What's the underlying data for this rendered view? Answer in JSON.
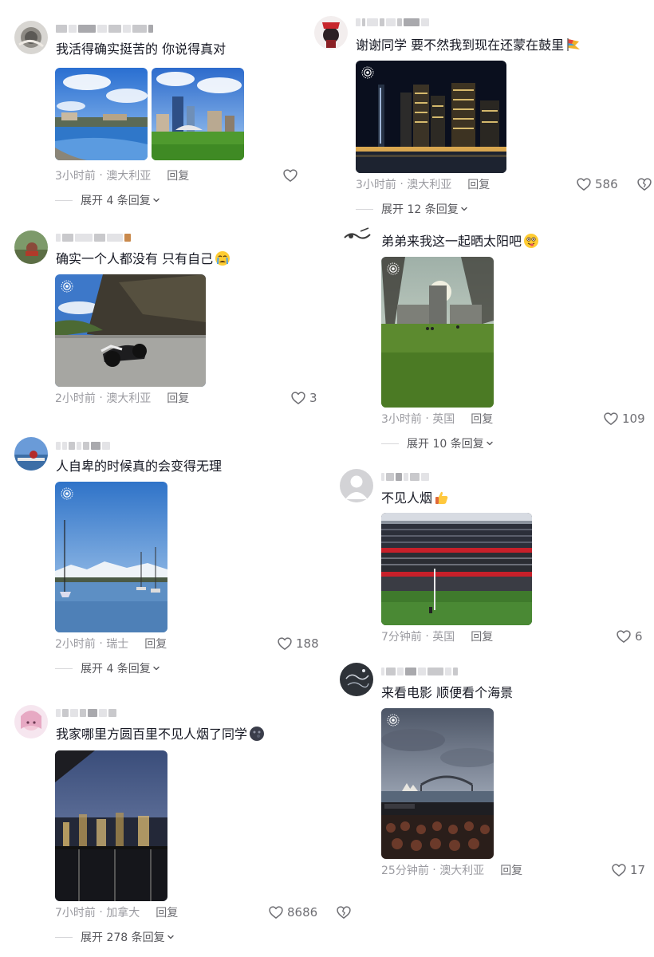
{
  "comments": [
    {
      "text": "我活得确实挺苦的 你说得真对",
      "time": "3小时前",
      "location": "澳大利亚",
      "reply": "回复",
      "likes": "",
      "expand": "展开 4 条回复"
    },
    {
      "text": "确实一个人都没有 只有自己",
      "time": "2小时前",
      "location": "澳大利亚",
      "reply": "回复",
      "likes": "3",
      "expand": ""
    },
    {
      "text": "人自卑的时候真的会变得无理",
      "time": "2小时前",
      "location": "瑞士",
      "reply": "回复",
      "likes": "188",
      "expand": "展开 4 条回复"
    },
    {
      "text": "我家哪里方圆百里不见人烟了同学",
      "time": "7小时前",
      "location": "加拿大",
      "reply": "回复",
      "likes": "8686",
      "expand": "展开 278 条回复"
    },
    {
      "text": "谢谢同学 要不然我到现在还蒙在鼓里",
      "time": "3小时前",
      "location": "澳大利亚",
      "reply": "回复",
      "likes": "586",
      "expand": "展开 12 条回复"
    },
    {
      "text": "弟弟来我这一起晒太阳吧",
      "time": "3小时前",
      "location": "英国",
      "reply": "回复",
      "likes": "109",
      "expand": "展开 10 条回复"
    },
    {
      "text": "不见人烟",
      "time": "7分钟前",
      "location": "英国",
      "reply": "回复",
      "likes": "6",
      "expand": ""
    },
    {
      "text": "来看电影 顺便看个海景",
      "time": "25分钟前",
      "location": "澳大利亚",
      "reply": "回复",
      "likes": "17",
      "expand": ""
    }
  ],
  "meta_separator": "·",
  "icons": {
    "like": "heart-outline-icon",
    "dislike": "broken-heart-icon",
    "expand": "chevron-down-icon",
    "live": "live-photo-icon"
  },
  "colors": {
    "text": "#161823",
    "meta": "#9b9ba1",
    "reply": "#6e6e73",
    "divider": "#d7d7da"
  }
}
